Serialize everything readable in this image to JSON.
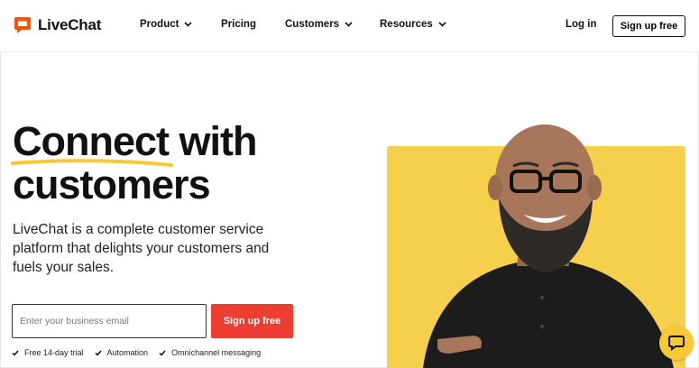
{
  "header": {
    "logo_text": "LiveChat",
    "nav": [
      {
        "label": "Product",
        "has_dropdown": true
      },
      {
        "label": "Pricing",
        "has_dropdown": false
      },
      {
        "label": "Customers",
        "has_dropdown": true
      },
      {
        "label": "Resources",
        "has_dropdown": true
      }
    ],
    "login_label": "Log in",
    "signup_label": "Sign up free"
  },
  "hero": {
    "title_line1": "Connect with",
    "title_line2": "customers",
    "description": "LiveChat is a complete customer service platform that delights your customers and fuels your sales.",
    "email_placeholder": "Enter your business email",
    "signup_label": "Sign up free",
    "features": [
      "Free 14-day trial",
      "Automation",
      "Omnichannel messaging"
    ]
  },
  "icons": {
    "logo": "livechat-logo-icon",
    "dropdown": "chevron-down-icon",
    "feature": "check-icon",
    "chat": "chat-bubble-icon"
  },
  "colors": {
    "brand_orange": "#ff5100",
    "cta_red": "#ec3f31",
    "accent_yellow": "#f6d04d",
    "text": "#111111"
  }
}
